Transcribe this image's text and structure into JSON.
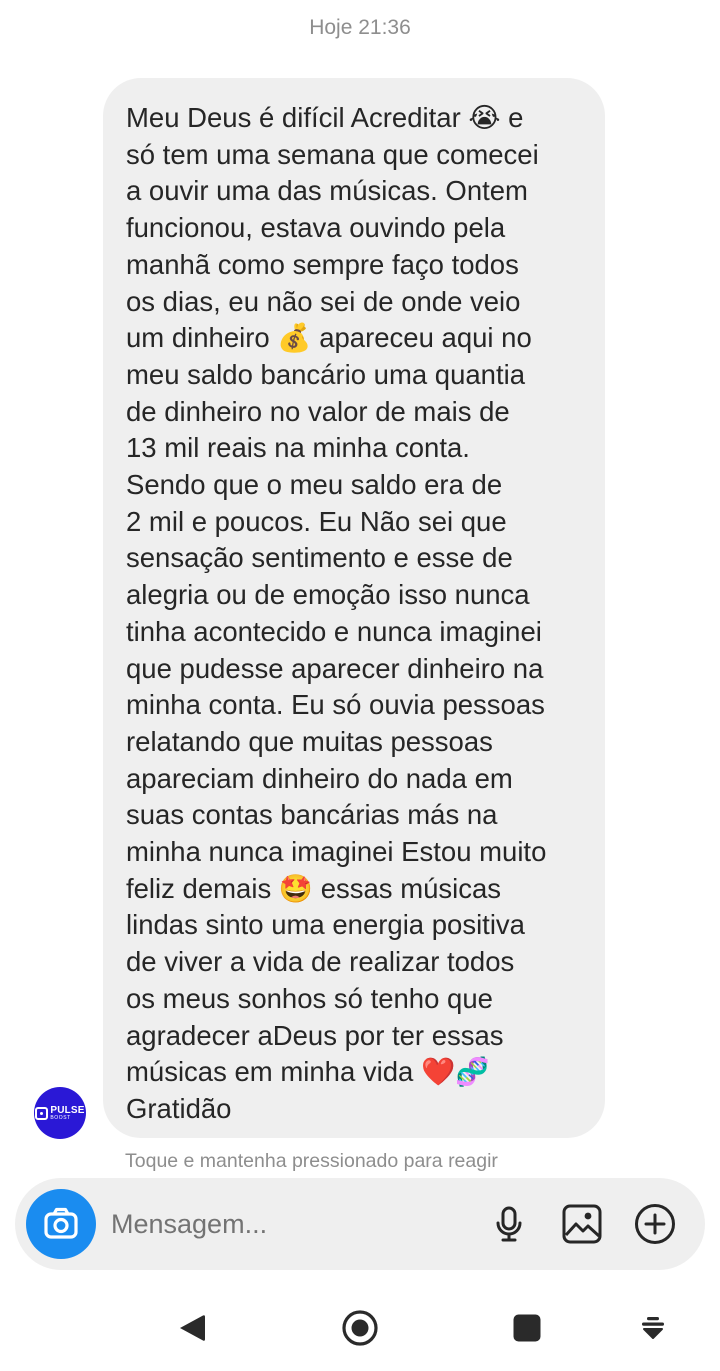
{
  "timestamp": "Hoje 21:36",
  "sender": {
    "avatar_brand": "PULSE",
    "avatar_sub": "BOOST",
    "avatar_color": "#2a18d6"
  },
  "message": {
    "lines": [
      "Meu Deus é difícil Acreditar 😭  e",
      "só tem uma semana que comecei",
      "a ouvir uma das músicas. Ontem",
      "funcionou, estava ouvindo pela",
      "manhã como sempre faço todos",
      "os dias, eu  não sei de onde veio",
      "um dinheiro 💰 apareceu aqui no",
      "meu saldo bancário uma quantia",
      "de dinheiro no valor de mais de",
      "13 mil reais na minha conta.",
      "Sendo que o meu saldo era de",
      "2 mil e poucos. Eu Não sei que",
      "sensação sentimento e esse de",
      "alegria ou de emoção isso nunca",
      "tinha acontecido e nunca imaginei",
      "que pudesse aparecer dinheiro na",
      "minha conta. Eu só ouvia pessoas",
      "relatando que muitas pessoas",
      "apareciam dinheiro do nada em",
      "suas contas bancárias más na",
      "minha nunca imaginei Estou muito",
      "feliz demais 🤩 essas músicas",
      "lindas sinto uma energia positiva",
      "de viver a vida de realizar todos",
      "os meus sonhos só tenho que",
      "agradecer aDeus por ter essas",
      "músicas em minha vida ❤️🧬",
      "Gratidão"
    ]
  },
  "hint": "Toque e mantenha pressionado para reagir",
  "composer": {
    "placeholder": "Mensagem...",
    "icons": [
      "camera-icon",
      "microphone-icon",
      "gallery-icon",
      "add-circle-icon"
    ],
    "accent": "#1a8cf0"
  },
  "navbar": {
    "icons": [
      "back-icon",
      "home-icon",
      "recents-icon",
      "hide-keyboard-icon"
    ]
  }
}
